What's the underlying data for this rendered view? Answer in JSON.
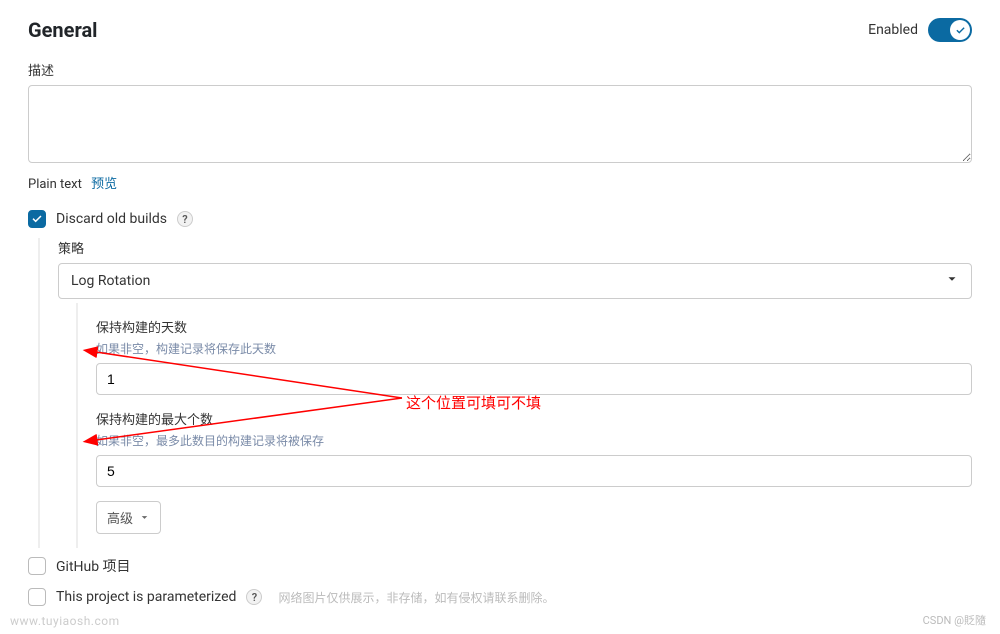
{
  "header": {
    "title": "General",
    "enabled_label": "Enabled",
    "enabled_state": true
  },
  "description": {
    "label": "描述",
    "value": "",
    "plain_text_label": "Plain text",
    "preview_label": "预览"
  },
  "discard": {
    "label": "Discard old builds",
    "checked": true,
    "strategy_label": "策略",
    "strategy_value": "Log Rotation",
    "days": {
      "label": "保持构建的天数",
      "hint": "如果非空，构建记录将保存此天数",
      "value": "1"
    },
    "max": {
      "label": "保持构建的最大个数",
      "hint": "如果非空，最多此数目的构建记录将被保存",
      "value": "5"
    },
    "advanced_label": "高级"
  },
  "github": {
    "label": "GitHub 项目",
    "checked": false
  },
  "parameterized": {
    "label": "This project is parameterized",
    "checked": false
  },
  "annotation": {
    "text": "这个位置可填可不填"
  },
  "watermark": {
    "left": "www.tuyiaosh.com",
    "disclaimer": "网络图片仅供展示，非存储，如有侵权请联系删除。",
    "right": "CSDN @貶隨"
  }
}
